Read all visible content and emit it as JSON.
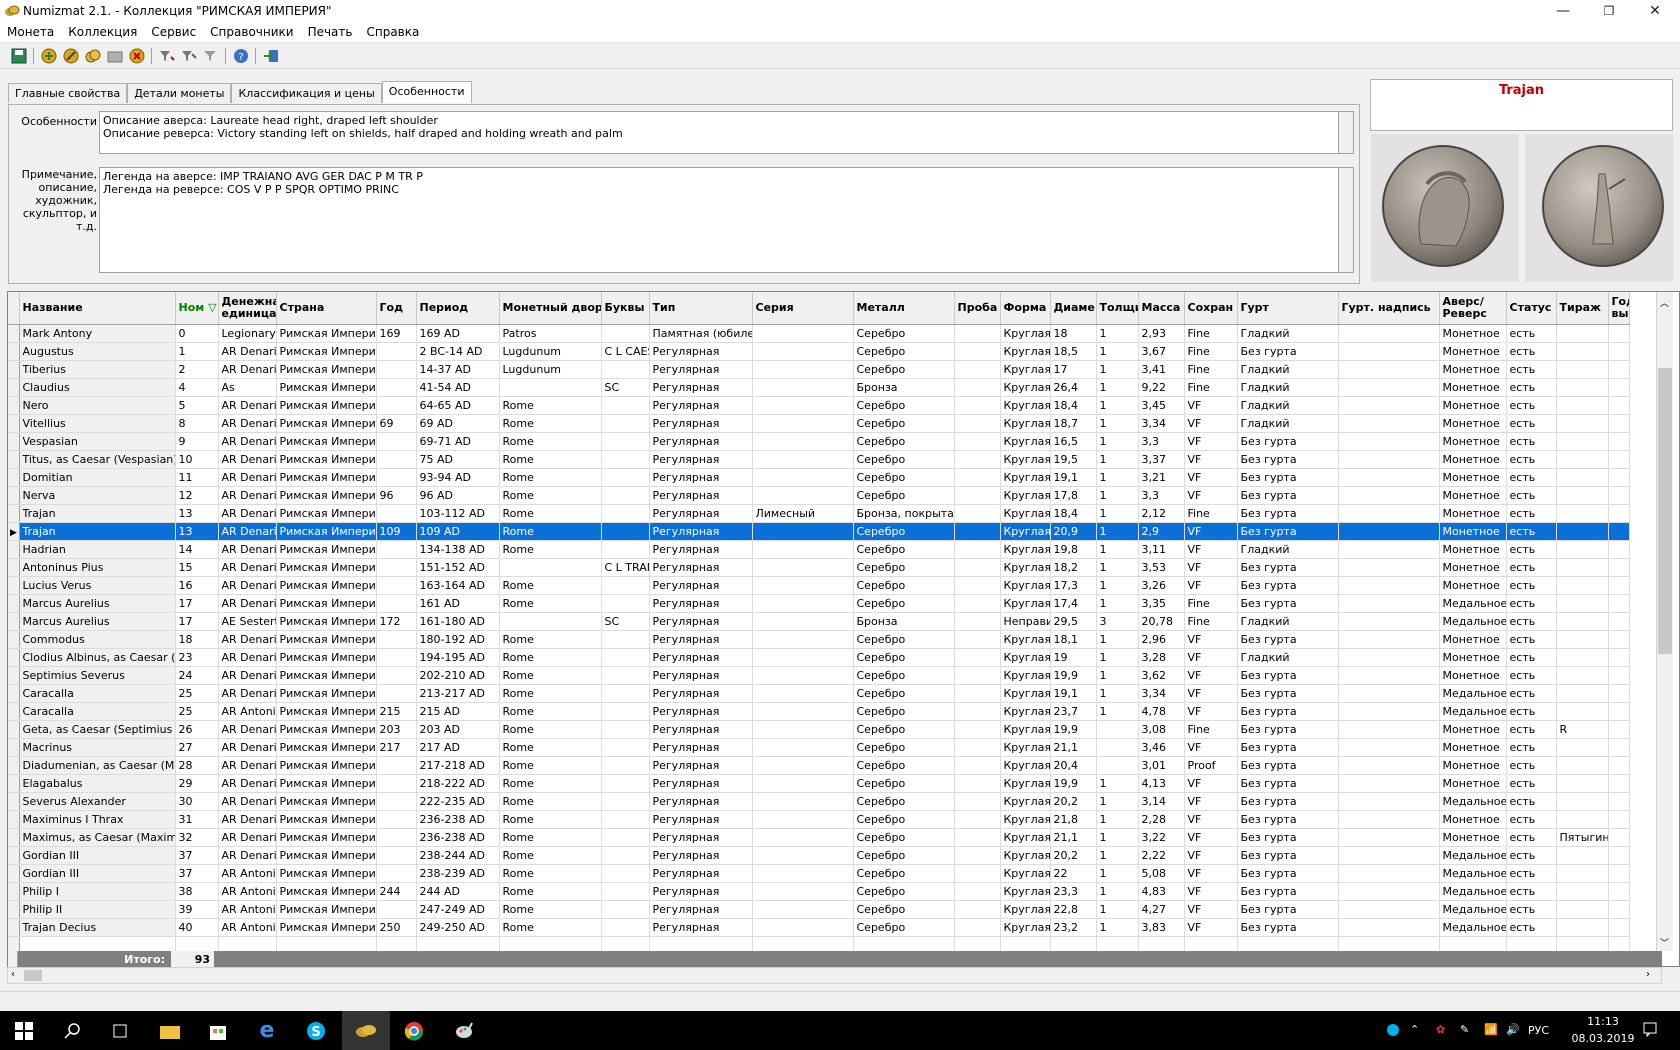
{
  "window": {
    "title": "Numizmat 2.1. - Коллекция \"РИМСКАЯ ИМПЕРИЯ\"",
    "minimize": "—",
    "maximize": "❐",
    "close": "✕"
  },
  "menu": [
    "Монета",
    "Коллекция",
    "Сервис",
    "Справочники",
    "Печать",
    "Справка"
  ],
  "toolbar": [
    "save-icon",
    "add-icon",
    "edit-icon",
    "copy-icon",
    "folder-icon",
    "delete-icon",
    "filter-icon",
    "filter-edit-icon",
    "filter-clear-icon",
    "help-icon",
    "exit-icon"
  ],
  "tabs": [
    "Главные свойства",
    "Детали монеты",
    "Классификация и цены",
    "Особенности"
  ],
  "active_tab": 3,
  "features": {
    "label_features": "Особенности",
    "features_text": "Описание аверса: Laureate head right, draped left shoulder\nОписание реверса: Victory standing left on shields, half draped and holding wreath and palm",
    "label_notes": "Примечание,\nописание,\nхудожник,\nскульптор, и\nт.д.",
    "notes_text": "Легенда на аверсе: IMP TRAIANO AVG GER DAC P M TR P\nЛегенда на реверсе: COS V P P SPQR OPTIMO PRINC"
  },
  "preview": {
    "coin_name": "Trajan"
  },
  "grid": {
    "columns": [
      "Название",
      "Ном ▽",
      "Денежная единица",
      "Страна",
      "Год",
      "Период",
      "Монетный двор",
      "Буквы",
      "Тип",
      "Серия",
      "Металл",
      "Проба",
      "Форма",
      "Диаметр",
      "Толщина",
      "Масса",
      "Сохранность",
      "Гурт",
      "Гурт. надпись",
      "Аверс/ Реверс",
      "Статус",
      "Тираж",
      "Год вып"
    ],
    "column_headers_display": [
      "Название",
      "Ном ▽",
      "Денежна единица",
      "Страна",
      "Год",
      "Период",
      "Монетный двор",
      "Буквы",
      "Тип",
      "Серия",
      "Металл",
      "Проба",
      "Форма",
      "Диаме",
      "Толщи",
      "Масса",
      "Сохран",
      "Гурт",
      "Гурт. надпись",
      "Аверс/ Реверс",
      "Статус",
      "Тираж",
      "Год вып"
    ],
    "selected_row": 11,
    "rows": [
      [
        "Mark Antony",
        "0",
        "Legionary AR",
        "Римская Империя",
        "169",
        "169 AD",
        "Patros",
        "",
        "Памятная (юбилейн",
        "",
        "Серебро",
        "",
        "Круглая",
        "18",
        "1",
        "2,93",
        "Fine",
        "Гладкий",
        "",
        "Монетное",
        "есть",
        "",
        ""
      ],
      [
        "Augustus",
        "1",
        "AR Denarius",
        "Римская Империя",
        "",
        "2 BC-14 AD",
        "Lugdunum",
        "C L CAES",
        "Регулярная",
        "",
        "Серебро",
        "",
        "Круглая",
        "18,5",
        "1",
        "3,67",
        "Fine",
        "Без гурта",
        "",
        "Монетное",
        "есть",
        "",
        ""
      ],
      [
        "Tiberius",
        "2",
        "AR Denarius",
        "Римская Империя",
        "",
        "14-37 AD",
        "Lugdunum",
        "",
        "Регулярная",
        "",
        "Серебро",
        "",
        "Круглая",
        "17",
        "1",
        "3,41",
        "Fine",
        "Гладкий",
        "",
        "Монетное",
        "есть",
        "",
        ""
      ],
      [
        "Claudius",
        "4",
        "As",
        "Римская Империя",
        "",
        "41-54 AD",
        "",
        "SC",
        "Регулярная",
        "",
        "Бронза",
        "",
        "Круглая",
        "26,4",
        "1",
        "9,22",
        "Fine",
        "Гладкий",
        "",
        "Монетное",
        "есть",
        "",
        ""
      ],
      [
        "Nero",
        "5",
        "AR Denarius",
        "Римская Империя",
        "",
        "64-65 AD",
        "Rome",
        "",
        "Регулярная",
        "",
        "Серебро",
        "",
        "Круглая",
        "18,4",
        "1",
        "3,45",
        "VF",
        "Гладкий",
        "",
        "Монетное",
        "есть",
        "",
        ""
      ],
      [
        "Vitellius",
        "8",
        "AR Denarius",
        "Римская Империя",
        "69",
        "69 AD",
        "Rome",
        "",
        "Регулярная",
        "",
        "Серебро",
        "",
        "Круглая",
        "18,7",
        "1",
        "3,34",
        "VF",
        "Гладкий",
        "",
        "Монетное",
        "есть",
        "",
        ""
      ],
      [
        "Vespasian",
        "9",
        "AR Denarius",
        "Римская Империя",
        "",
        "69-71 AD",
        "Rome",
        "",
        "Регулярная",
        "",
        "Серебро",
        "",
        "Круглая",
        "16,5",
        "1",
        "3,3",
        "VF",
        "Без гурта",
        "",
        "Монетное",
        "есть",
        "",
        ""
      ],
      [
        "Titus, as Caesar (Vespasian)",
        "10",
        "AR Denarius",
        "Римская Империя",
        "",
        "75 AD",
        "Rome",
        "",
        "Регулярная",
        "",
        "Серебро",
        "",
        "Круглая",
        "19,5",
        "1",
        "3,37",
        "VF",
        "Без гурта",
        "",
        "Монетное",
        "есть",
        "",
        ""
      ],
      [
        "Domitian",
        "11",
        "AR Denarius",
        "Римская Империя",
        "",
        "93-94 AD",
        "Rome",
        "",
        "Регулярная",
        "",
        "Серебро",
        "",
        "Круглая",
        "19,1",
        "1",
        "3,21",
        "VF",
        "Без гурта",
        "",
        "Монетное",
        "есть",
        "",
        ""
      ],
      [
        "Nerva",
        "12",
        "AR Denarius",
        "Римская Империя",
        "96",
        "96 AD",
        "Rome",
        "",
        "Регулярная",
        "",
        "Серебро",
        "",
        "Круглая",
        "17,8",
        "1",
        "3,3",
        "VF",
        "Без гурта",
        "",
        "Монетное",
        "есть",
        "",
        ""
      ],
      [
        "Trajan",
        "13",
        "AR Denarius",
        "Римская Империя",
        "",
        "103-112 AD",
        "Rome",
        "",
        "Регулярная",
        "Лимесный",
        "Бронза, покрытая с",
        "",
        "Круглая",
        "18,4",
        "1",
        "2,12",
        "Fine",
        "Без гурта",
        "",
        "Монетное",
        "есть",
        "",
        ""
      ],
      [
        "Trajan",
        "13",
        "AR Denarius",
        "Римская Империя",
        "109",
        "109 AD",
        "Rome",
        "",
        "Регулярная",
        "",
        "Серебро",
        "",
        "Круглая",
        "20,9",
        "1",
        "2,9",
        "VF",
        "Без гурта",
        "",
        "Монетное",
        "есть",
        "",
        ""
      ],
      [
        "Hadrian",
        "14",
        "AR Denarius",
        "Римская Империя",
        "",
        "134-138 AD",
        "Rome",
        "",
        "Регулярная",
        "",
        "Серебро",
        "",
        "Круглая",
        "19,8",
        "1",
        "3,11",
        "VF",
        "Гладкий",
        "",
        "Монетное",
        "есть",
        "",
        ""
      ],
      [
        "Antoninus Pius",
        "15",
        "AR Denarius",
        "Римская Империя",
        "",
        "151-152 AD",
        "",
        "C L TRAN",
        "Регулярная",
        "",
        "Серебро",
        "",
        "Круглая",
        "18,2",
        "1",
        "3,53",
        "VF",
        "Без гурта",
        "",
        "Монетное",
        "есть",
        "",
        ""
      ],
      [
        "Lucius Verus",
        "16",
        "AR Denarius",
        "Римская Империя",
        "",
        "163-164 AD",
        "Rome",
        "",
        "Регулярная",
        "",
        "Серебро",
        "",
        "Круглая",
        "17,3",
        "1",
        "3,26",
        "VF",
        "Без гурта",
        "",
        "Монетное",
        "есть",
        "",
        ""
      ],
      [
        "Marcus Aurelius",
        "17",
        "AR Denarius",
        "Римская Империя",
        "",
        "161 AD",
        "Rome",
        "",
        "Регулярная",
        "",
        "Серебро",
        "",
        "Круглая",
        "17,4",
        "1",
        "3,35",
        "Fine",
        "Без гурта",
        "",
        "Медальное",
        "есть",
        "",
        ""
      ],
      [
        "Marcus Aurelius",
        "17",
        "AE Sestertius",
        "Римская Империя",
        "172",
        "161-180 AD",
        "",
        "SC",
        "Регулярная",
        "",
        "Бронза",
        "",
        "Неправильная",
        "29,5",
        "3",
        "20,78",
        "Fine",
        "Гладкий",
        "",
        "Медальное",
        "есть",
        "",
        ""
      ],
      [
        "Commodus",
        "18",
        "AR Denarius",
        "Римская Империя",
        "",
        "180-192 AD",
        "Rome",
        "",
        "Регулярная",
        "",
        "Серебро",
        "",
        "Круглая",
        "18,1",
        "1",
        "2,96",
        "VF",
        "Без гурта",
        "",
        "Монетное",
        "есть",
        "",
        ""
      ],
      [
        "Clodius Albinus, as Caesar (Septimius",
        "23",
        "AR Denarius",
        "Римская Империя",
        "",
        "194-195 AD",
        "Rome",
        "",
        "Регулярная",
        "",
        "Серебро",
        "",
        "Круглая",
        "19",
        "1",
        "3,28",
        "VF",
        "Гладкий",
        "",
        "Монетное",
        "есть",
        "",
        ""
      ],
      [
        "Septimius Severus",
        "24",
        "AR Denarius",
        "Римская Империя",
        "",
        "202-210 AD",
        "Rome",
        "",
        "Регулярная",
        "",
        "Серебро",
        "",
        "Круглая",
        "19,9",
        "1",
        "3,62",
        "VF",
        "Без гурта",
        "",
        "Монетное",
        "есть",
        "",
        ""
      ],
      [
        "Caracalla",
        "25",
        "AR Denarius",
        "Римская Империя",
        "",
        "213-217 AD",
        "Rome",
        "",
        "Регулярная",
        "",
        "Серебро",
        "",
        "Круглая",
        "19,1",
        "1",
        "3,34",
        "VF",
        "Без гурта",
        "",
        "Медальное",
        "есть",
        "",
        ""
      ],
      [
        "Caracalla",
        "25",
        "AR Antoninianus",
        "Римская Империя",
        "215",
        "215 AD",
        "Rome",
        "",
        "Регулярная",
        "",
        "Серебро",
        "",
        "Круглая",
        "23,7",
        "1",
        "4,78",
        "VF",
        "Без гурта",
        "",
        "Медальное",
        "есть",
        "",
        ""
      ],
      [
        "Geta, as Caesar (Septimius Severus)",
        "26",
        "AR Denarius",
        "Римская Империя",
        "203",
        "203 AD",
        "Rome",
        "",
        "Регулярная",
        "",
        "Серебро",
        "",
        "Круглая",
        "19,9",
        "",
        "3,08",
        "Fine",
        "Без гурта",
        "",
        "Монетное",
        "есть",
        "R",
        ""
      ],
      [
        "Macrinus",
        "27",
        "AR Denarius",
        "Римская Империя",
        "217",
        "217 AD",
        "Rome",
        "",
        "Регулярная",
        "",
        "Серебро",
        "",
        "Круглая",
        "21,1",
        "",
        "3,46",
        "VF",
        "Без гурта",
        "",
        "Монетное",
        "есть",
        "",
        ""
      ],
      [
        "Diadumenian, as Caesar (Macrinus)",
        "28",
        "AR Denarius",
        "Римская Империя",
        "",
        "217-218 AD",
        "Rome",
        "",
        "Регулярная",
        "",
        "Серебро",
        "",
        "Круглая",
        "20,4",
        "",
        "3,01",
        "Proof",
        "Без гурта",
        "",
        "Монетное",
        "есть",
        "",
        ""
      ],
      [
        "Elagabalus",
        "29",
        "AR Denarius",
        "Римская Империя",
        "",
        "218-222 AD",
        "Rome",
        "",
        "Регулярная",
        "",
        "Серебро",
        "",
        "Круглая",
        "19,9",
        "1",
        "4,13",
        "VF",
        "Без гурта",
        "",
        "Монетное",
        "есть",
        "",
        ""
      ],
      [
        "Severus Alexander",
        "30",
        "AR Denarius",
        "Римская Империя",
        "",
        "222-235 AD",
        "Rome",
        "",
        "Регулярная",
        "",
        "Серебро",
        "",
        "Круглая",
        "20,2",
        "1",
        "3,14",
        "VF",
        "Без гурта",
        "",
        "Медальное",
        "есть",
        "",
        ""
      ],
      [
        "Maximinus I Thrax",
        "31",
        "AR Denarius",
        "Римская Империя",
        "",
        "236-238 AD",
        "Rome",
        "",
        "Регулярная",
        "",
        "Серебро",
        "",
        "Круглая",
        "21,8",
        "1",
        "2,28",
        "VF",
        "Без гурта",
        "",
        "Монетное",
        "есть",
        "",
        ""
      ],
      [
        "Maximus, as Caesar (Maximinus",
        "32",
        "AR Denarius",
        "Римская Империя",
        "",
        "236-238 AD",
        "Rome",
        "",
        "Регулярная",
        "",
        "Серебро",
        "",
        "Круглая",
        "21,1",
        "1",
        "3,22",
        "VF",
        "Без гурта",
        "",
        "Монетное",
        "есть",
        "Пятыгин",
        ""
      ],
      [
        "Gordian III",
        "37",
        "AR Denarius",
        "Римская Империя",
        "",
        "238-244 AD",
        "Rome",
        "",
        "Регулярная",
        "",
        "Серебро",
        "",
        "Круглая",
        "20,2",
        "1",
        "2,22",
        "VF",
        "Без гурта",
        "",
        "Медальное",
        "есть",
        "",
        ""
      ],
      [
        "Gordian III",
        "37",
        "AR Antoninianus",
        "Римская Империя",
        "",
        "238-239 AD",
        "Rome",
        "",
        "Регулярная",
        "",
        "Серебро",
        "",
        "Круглая",
        "22",
        "1",
        "5,08",
        "VF",
        "Без гурта",
        "",
        "Медальное",
        "есть",
        "",
        ""
      ],
      [
        "Philip I",
        "38",
        "AR Antoninianus",
        "Римская Империя",
        "244",
        "244 AD",
        "Rome",
        "",
        "Регулярная",
        "",
        "Серебро",
        "",
        "Круглая",
        "23,3",
        "1",
        "4,83",
        "VF",
        "Без гурта",
        "",
        "Медальное",
        "есть",
        "",
        ""
      ],
      [
        "Philip II",
        "39",
        "AR Antoninianus",
        "Римская Империя",
        "",
        "247-249 AD",
        "Rome",
        "",
        "Регулярная",
        "",
        "Серебро",
        "",
        "Круглая",
        "22,8",
        "1",
        "4,27",
        "VF",
        "Без гурта",
        "",
        "Медальное",
        "есть",
        "",
        ""
      ],
      [
        "Trajan Decius",
        "40",
        "AR Antoninianus",
        "Римская Империя",
        "250",
        "249-250 AD",
        "Rome",
        "",
        "Регулярная",
        "",
        "Серебро",
        "",
        "Круглая",
        "23,2",
        "1",
        "3,83",
        "VF",
        "Без гурта",
        "",
        "Медальное",
        "есть",
        "",
        ""
      ]
    ],
    "footer": {
      "label": "Итого:",
      "count": "93"
    }
  },
  "taskbar": {
    "language": "РУС",
    "time": "11:13",
    "date": "08.03.2019"
  },
  "colors": {
    "selection": "#0a70d8",
    "coin_name": "#c00000",
    "sort_header": "#008000"
  }
}
